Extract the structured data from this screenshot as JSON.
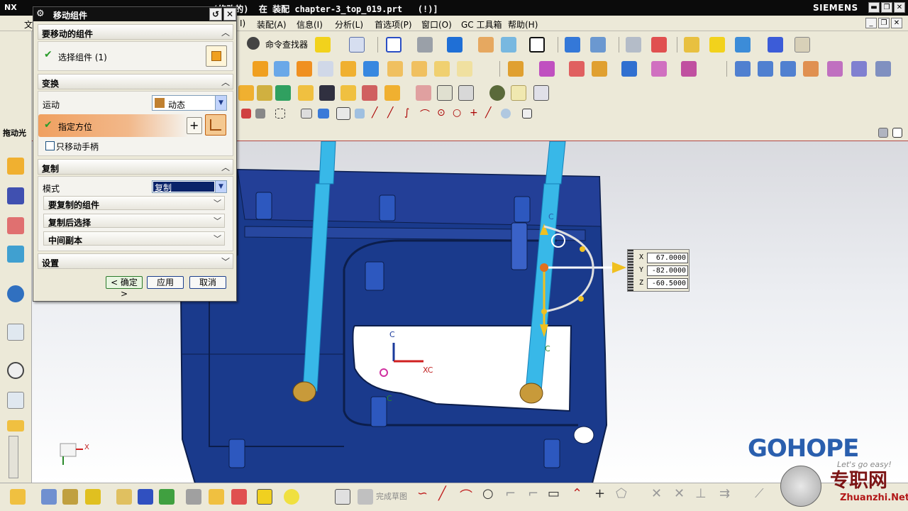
{
  "titlebar": {
    "app": "NX",
    "title": "(修改的)  在 装配 chapter-3_top_019.prt   (!)]",
    "brand": "SIEMENS",
    "minimize": "▬",
    "maximize": "❐",
    "close": "✕"
  },
  "menubar": {
    "items": [
      "文",
      "I)",
      "装配(A)",
      "信息(I)",
      "分析(L)",
      "首选项(P)",
      "窗口(O)",
      "GC 工具箱",
      "帮助(H)"
    ],
    "mdi_minimize": "_",
    "mdi_restore": "❐",
    "mdi_close": "✕"
  },
  "toolbar": {
    "command_finder": "命令查找器",
    "finish_sketch": "完成草图"
  },
  "leftbar": {
    "label": "拖动光"
  },
  "dialog": {
    "title": "移动组件",
    "gear": "⚙",
    "reset": "↺",
    "close": "✕",
    "sections": {
      "components": {
        "header": "要移动的组件",
        "select_label": "选择组件 (1)",
        "chevron": "︿"
      },
      "transform": {
        "header": "变换",
        "motion_label": "运动",
        "motion_value": "动态",
        "orient_label": "指定方位",
        "move_handle_only": "只移动手柄",
        "chevron": "︿"
      },
      "copy": {
        "header": "复制",
        "mode_label": "模式",
        "mode_value": "复制",
        "sub_items": [
          "要复制的组件",
          "复制后选择",
          "中间副本"
        ],
        "chevron": "︿",
        "sub_chevron": "﹀"
      },
      "settings": {
        "header": "设置",
        "chevron": "﹀"
      }
    },
    "buttons": {
      "ok": "< 确定 >",
      "apply": "应用",
      "cancel": "取消"
    }
  },
  "coords": {
    "x_label": "X",
    "x_value": "67.0000",
    "y_label": "Y",
    "y_value": "-82.0000",
    "z_label": "Z",
    "z_value": "-60.5000"
  },
  "viewport": {
    "labels": {
      "xc": "XC",
      "c_top": "C",
      "c_bottom": "C",
      "c_center": "C",
      "c_lower": "C",
      "triad_x": "X"
    }
  },
  "watermark": {
    "logo": "GOHOPE",
    "tagline": "Let's go easy!",
    "cn": "专职网",
    "url": "Zhuanzhi.Net"
  },
  "colors": {
    "model_blue": "#1a3a8c",
    "rod_cyan": "#38b8e8",
    "accent_orange": "#f0a060"
  }
}
